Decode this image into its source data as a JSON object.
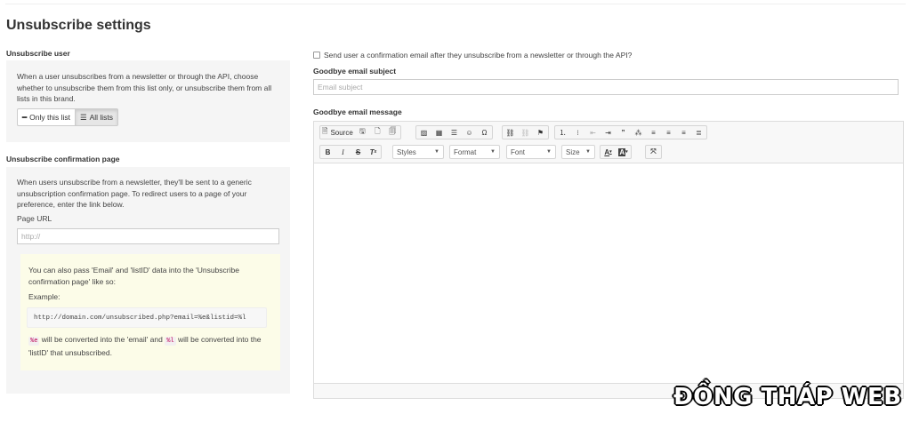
{
  "page_title": "Unsubscribe settings",
  "unsubscribe_user": {
    "heading": "Unsubscribe user",
    "description": "When a user unsubscribes from a newsletter or through the API, choose whether to unsubscribe them from this list only, or unsubscribe them from all lists in this brand.",
    "option_this_list": "Only this list",
    "option_all_lists": "All lists",
    "selected": "All lists"
  },
  "confirmation_page": {
    "heading": "Unsubscribe confirmation page",
    "description": "When users unsubscribe from a newsletter, they'll be sent to a generic unsubscription confirmation page. To redirect users to a page of your preference, enter the link below.",
    "url_label": "Page URL",
    "url_placeholder": "http://",
    "tip_line1": "You can also pass 'Email' and 'listID' data into the 'Unsubscribe confirmation page' like so:",
    "example_label": "Example:",
    "example_code": "http://domain.com/unsubscribed.php?email=%e&listid=%l",
    "tag_email": "%e",
    "text_middle": "will be converted into the 'email' and",
    "tag_list": "%l",
    "text_end": "will be converted into the 'listID' that unsubscribed."
  },
  "goodbye": {
    "send_confirmation_label": "Send user a confirmation email after they unsubscribe from a newsletter or through the API?",
    "send_confirmation_checked": false,
    "subject_label": "Goodbye email subject",
    "subject_placeholder": "Email subject",
    "message_label": "Goodbye email message"
  },
  "editor": {
    "source_label": "Source",
    "styles_label": "Styles",
    "format_label": "Format",
    "font_label": "Font",
    "size_label": "Size"
  },
  "watermark": "ĐỒNG THÁP WEB"
}
